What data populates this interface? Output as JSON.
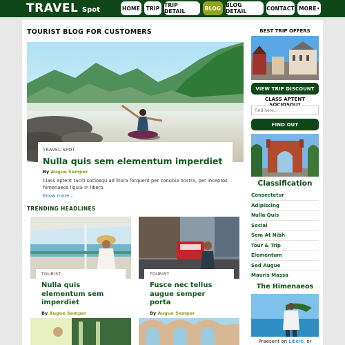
{
  "header": {
    "logo_main": "TRAVEL",
    "logo_sub": "Spot",
    "nav": [
      "HOME",
      "TRIP",
      "TRIP DETAIL",
      "BLOG",
      "BLOG DETAIL",
      "CONTACT",
      "MORE"
    ],
    "active_nav": "BLOG",
    "colors": {
      "header_bg": "#0f4719",
      "active": "#93a31a"
    }
  },
  "main": {
    "page_title": "TOURIST BLOG FOR CUSTOMERS",
    "feature": {
      "tag": "TRAVEL SPOT",
      "title": "Nulla quis sem elementum imperdiet",
      "by_label": "By",
      "author": "Augue Semper",
      "excerpt": "Class aptent taciti sociosqu ad litora forquent per conubia nostra, per inceptos himenaeos ligula in libero.",
      "more": "Know more..."
    },
    "trending_title": "TRENDING HEADLINES",
    "trending": [
      {
        "tag": "TOURIST",
        "title": "Nulla quis elementum sem imperdiet",
        "by_label": "By",
        "author": "Augue Semper"
      },
      {
        "tag": "TOURIST",
        "title": "Fusce nec tellus augue semper porta",
        "by_label": "By",
        "author": "Augue Semper"
      }
    ]
  },
  "sidebar": {
    "offers_title": "BEST TRIP OFFERS",
    "discount_button": "VIEW TRIP DISCOUNT",
    "search_label": "CLASS APTENT SOCIOSQU?",
    "search_placeholder": "Find here...",
    "find_button": "FIND OUT",
    "classification_title": "Classification",
    "categories": [
      "Consectetur",
      "Adipiscing",
      "Nulla Quis",
      "Social",
      "Sem At Nibh",
      "Tour & Trip",
      "Elementum",
      "Sed Augue",
      "Mauris Massa"
    ],
    "himenaeos_title": "The Himenaeos",
    "bottom_text_pre": "Praesent on",
    "bottom_text_link": "Libero,",
    "bottom_text_post": "or"
  }
}
